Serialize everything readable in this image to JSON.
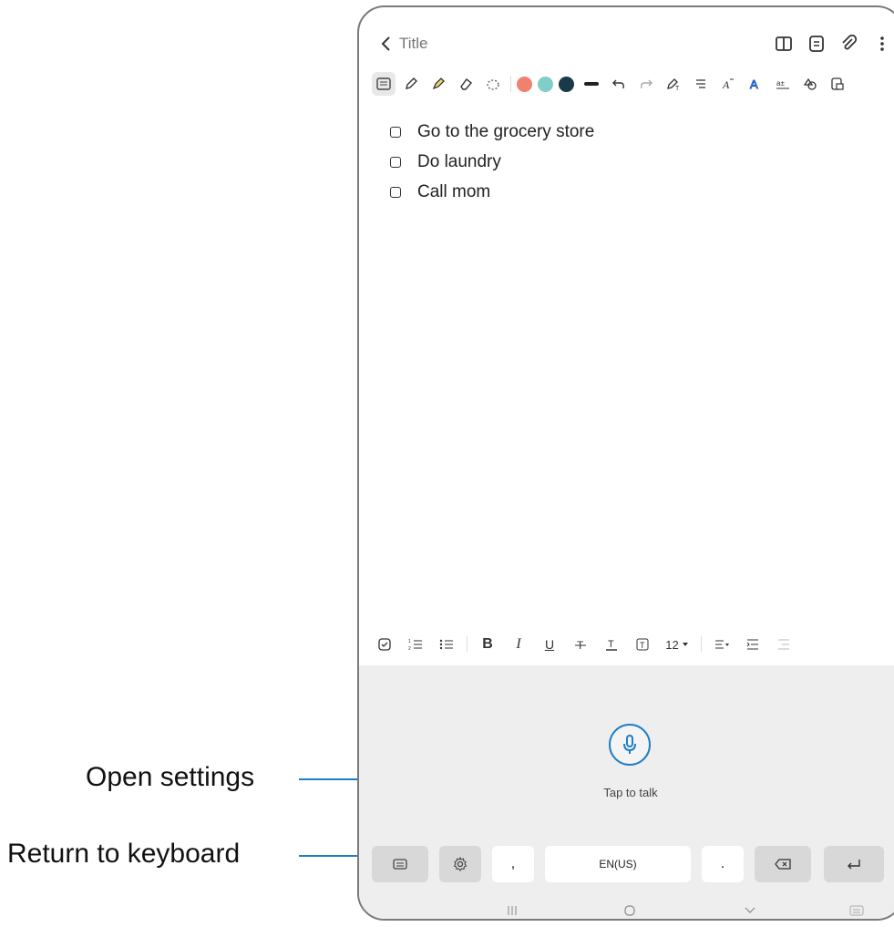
{
  "header": {
    "title_placeholder": "Title"
  },
  "note": {
    "checklist": [
      "Go to the grocery store",
      "Do laundry",
      "Call mom"
    ]
  },
  "toolbar": {
    "colors": [
      "#f08070",
      "#7fcfc8",
      "#1a3a4a"
    ]
  },
  "format_bar": {
    "bold": "B",
    "italic": "I",
    "underline": "U",
    "font_size": "12"
  },
  "voice": {
    "caption": "Tap to talk"
  },
  "keys": {
    "comma": ",",
    "space": "EN(US)",
    "period": "."
  },
  "annotations": {
    "open_settings": "Open settings",
    "return_to_keyboard": "Return to keyboard"
  },
  "accent_color": "#1e7ec8"
}
